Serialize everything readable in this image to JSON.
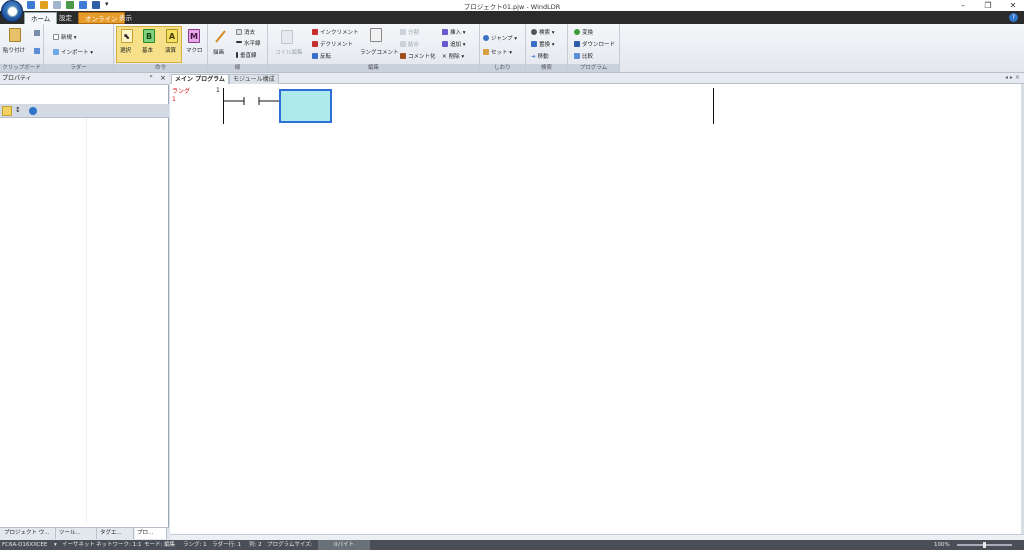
{
  "window": {
    "title": "プロジェクト01.pjw - WindLDR",
    "minimize": "–",
    "restore": "❐",
    "close": "✕",
    "help": "?"
  },
  "tabs": [
    {
      "label": "ホーム",
      "active": true
    },
    {
      "label": "設定"
    },
    {
      "label": "オンライン",
      "highlight": true
    },
    {
      "label": "表示"
    }
  ],
  "ribbon": {
    "clipboard": {
      "label": "クリップボード",
      "paste": "貼り付け"
    },
    "ladder": {
      "label": "ラダー",
      "new": "新規",
      "import": "インポート"
    },
    "symbol": {
      "label": "命令",
      "select": "選択",
      "basic": "基本",
      "calc": "演算",
      "macro": "マクロ",
      "basic_icon": "B",
      "calc_icon": "A",
      "macro_icon": "M"
    },
    "line": {
      "label": "線",
      "draw": "描画",
      "erase": "消去",
      "hline": "水平線",
      "vline": "垂直線"
    },
    "edit": {
      "label": "編集",
      "coil_edit": "コイル編集",
      "increment": "インクリメント",
      "decrement": "デクリメント",
      "invert": "反転",
      "rung_comment": "ラングコメント",
      "split": "分割",
      "join": "結合",
      "comment_convert": "コメント化",
      "insert": "挿入",
      "add": "追加",
      "delete": "削除"
    },
    "bookmark": {
      "label": "しおり",
      "jump": "ジャンプ",
      "set": "セット"
    },
    "search": {
      "label": "検索",
      "find": "検索",
      "replace": "置換",
      "move": "移動"
    },
    "program": {
      "label": "プログラム",
      "convert": "変換",
      "download": "ダウンロード",
      "compare": "比較"
    }
  },
  "left_panel": {
    "header": "プロパティ",
    "pin": "ᵖ",
    "close": "×",
    "tabs": [
      "プロジェクト ウ...",
      "ツール...",
      "タグエ...",
      "プロ..."
    ]
  },
  "editor": {
    "tabs": [
      {
        "label": "メイン プログラム",
        "active": true
      },
      {
        "label": "モジュール構成"
      }
    ],
    "nav": "◂ ▸ ×",
    "rung_header": "ラング",
    "rung_number": "1",
    "line_number": "1"
  },
  "statusbar": {
    "plc": "FC6A-D16XXCEE",
    "conn": "イーサネット",
    "network": "ネットワーク: 1:1",
    "mode": "モード: 編集",
    "rung": "ラング: 1",
    "ladder_line": "ラダー行: 1",
    "column": "列: 2",
    "size": "プログラムサイズ:",
    "size_value": "0バイト",
    "zoom": "100%"
  },
  "colors": {
    "accent": "#2d6fd6",
    "cursor_fill": "#aeeaea",
    "online_tab": "#e79b2a",
    "rung_label": "#dd1111"
  }
}
